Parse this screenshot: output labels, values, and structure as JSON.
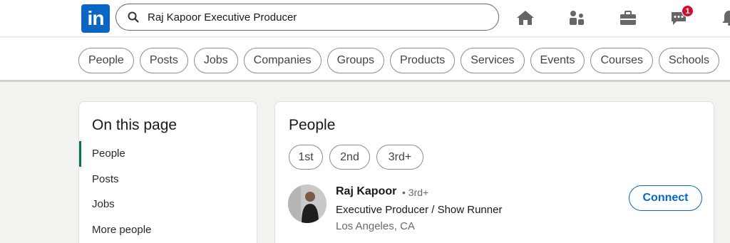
{
  "header": {
    "logo_text": "in",
    "search": {
      "value": "Raj Kapoor Executive Producer",
      "icon": "search-icon"
    },
    "nav": [
      {
        "name": "home-icon"
      },
      {
        "name": "my-network-icon"
      },
      {
        "name": "jobs-briefcase-icon"
      },
      {
        "name": "messaging-icon",
        "badge": "1"
      },
      {
        "name": "notifications-bell-icon"
      }
    ]
  },
  "filters": [
    "People",
    "Posts",
    "Jobs",
    "Companies",
    "Groups",
    "Products",
    "Services",
    "Events",
    "Courses",
    "Schools"
  ],
  "sidebar": {
    "title": "On this page",
    "items": [
      "People",
      "Posts",
      "Jobs",
      "More people"
    ]
  },
  "main": {
    "title": "People",
    "connections": [
      "1st",
      "2nd",
      "3rd+"
    ],
    "result": {
      "name": "Raj Kapoor",
      "degree": "• 3rd+",
      "headline": "Executive Producer / Show Runner",
      "location": "Los Angeles, CA",
      "action": "Connect"
    }
  },
  "colors": {
    "brand": "#0a66c2",
    "active_nav": "#01754f",
    "badge": "#cb112d"
  }
}
